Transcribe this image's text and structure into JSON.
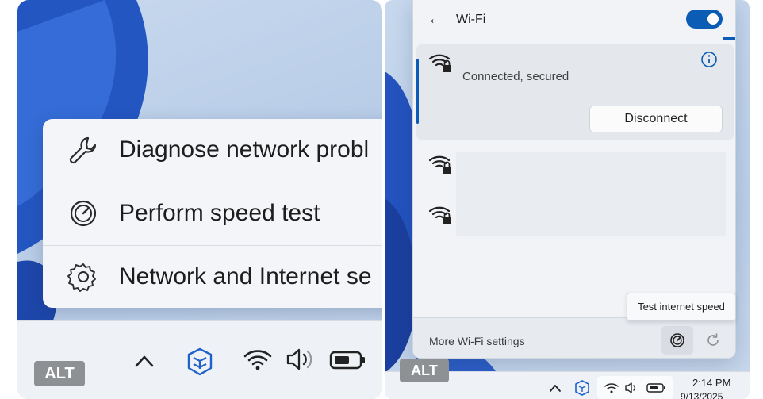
{
  "left_panel": {
    "context_menu": {
      "items": [
        {
          "label": "Diagnose network probl",
          "icon": "wrench-icon"
        },
        {
          "label": "Perform speed test",
          "icon": "speedometer-icon"
        },
        {
          "label": "Network and Internet se",
          "icon": "gear-icon"
        }
      ]
    },
    "taskbar": {
      "alt_badge": "ALT",
      "icons": [
        "chevron-up-icon",
        "network-app-icon",
        "wifi-icon",
        "volume-icon",
        "battery-icon"
      ]
    }
  },
  "right_panel": {
    "flyout": {
      "title": "Wi-Fi",
      "wifi_enabled": true,
      "connected_network": {
        "status": "Connected, secured",
        "button_label": "Disconnect"
      },
      "other_networks_count_visible": 2,
      "footer": {
        "more_settings": "More Wi-Fi settings"
      },
      "tooltip": "Test internet speed"
    },
    "taskbar": {
      "alt_badge": "ALT",
      "time": "2:14 PM",
      "date": "9/13/2025"
    }
  },
  "colors": {
    "accent": "#0b5cb5",
    "flyout_bg": "#f1f3f7",
    "wallpaper": "#c3d4ea"
  }
}
